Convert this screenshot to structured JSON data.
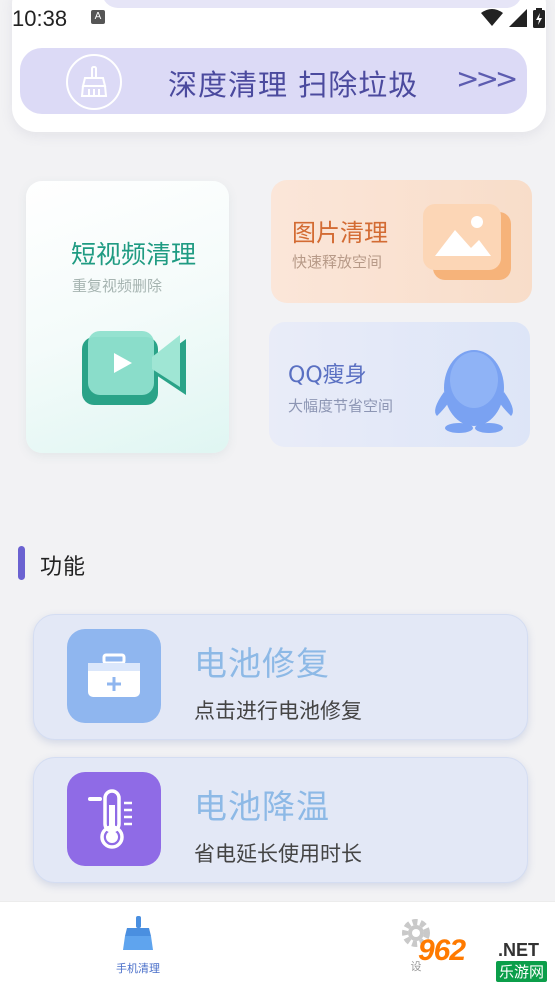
{
  "status_bar": {
    "time": "10:38",
    "notification_glyph": "A"
  },
  "deep_clean": {
    "label": "深度清理  扫除垃圾",
    "arrow": ">>>",
    "icon": "broom-icon"
  },
  "cards": {
    "video": {
      "title": "短视频清理",
      "subtitle": "重复视频删除",
      "icon": "video-camera-icon"
    },
    "image": {
      "title": "图片清理",
      "subtitle": "快速释放空间",
      "icon": "picture-icon"
    },
    "qq": {
      "title": "QQ瘦身",
      "subtitle": "大幅度节省空间",
      "icon": "penguin-icon"
    }
  },
  "section": {
    "title": "功能"
  },
  "functions": [
    {
      "title": "电池修复",
      "subtitle": "点击进行电池修复",
      "icon": "first-aid-kit-icon",
      "icon_color": "#8fb6ef"
    },
    {
      "title": "电池降温",
      "subtitle": "省电延长使用时长",
      "icon": "thermometer-icon",
      "icon_color": "#8f6be6"
    }
  ],
  "bottom_nav": {
    "home_label": "手机清理",
    "settings_label": "设"
  },
  "watermark": {
    "number": "962",
    "net": ".NET",
    "site": "乐游网"
  },
  "colors": {
    "accent": "#6b62d1",
    "video_title": "#1f9b82",
    "image_title": "#d36b33",
    "qq_title": "#5a70c2",
    "function_title": "#8db9e6"
  }
}
